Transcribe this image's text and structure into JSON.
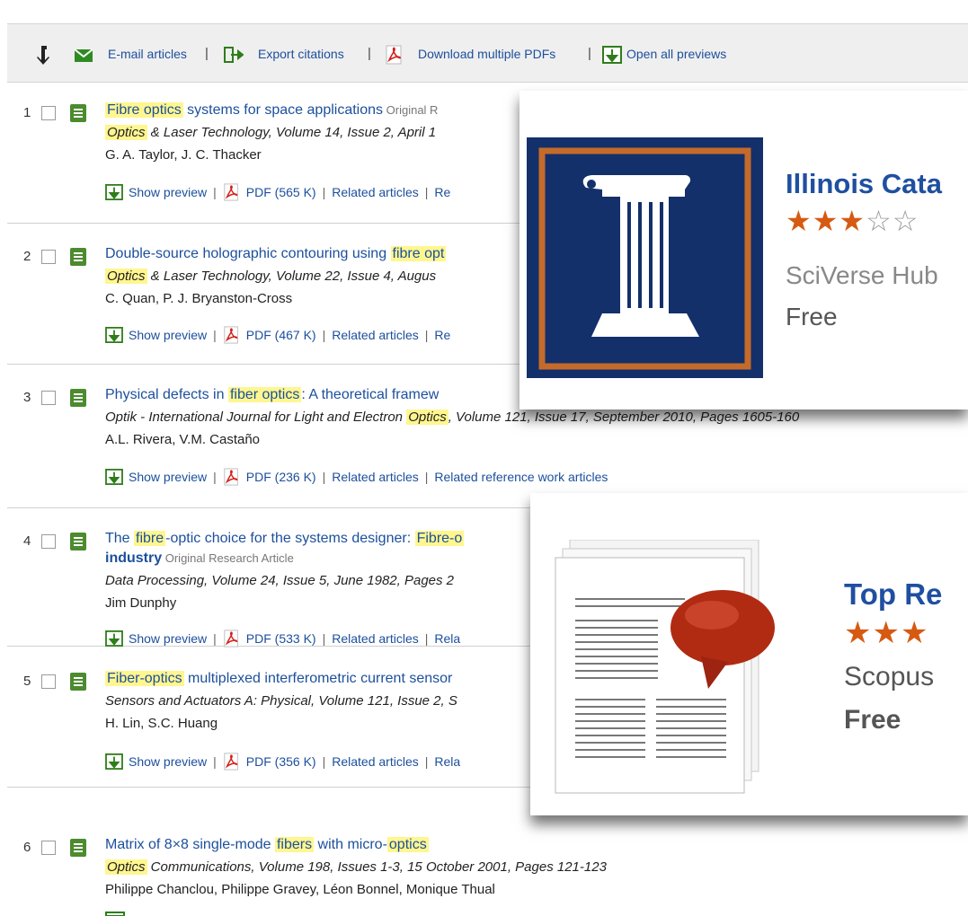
{
  "toolbar": {
    "email": "E-mail articles",
    "export": "Export citations",
    "download": "Download multiple PDFs",
    "open_previews": "Open all previews",
    "sep": "|"
  },
  "results": [
    {
      "num": "1",
      "title_hl": "Fibre optics",
      "title_rest": " systems for space applications",
      "type": " Original R",
      "src_hl": "Optics",
      "src_rest": " & Laser Technology, Volume 14, Issue 2, April 1",
      "authors": "G. A. Taylor, J. C. Thacker",
      "preview": "Show preview",
      "pdf": "PDF (565 K)",
      "related": "Related articles",
      "related_tail": "Re"
    },
    {
      "num": "2",
      "title_pre": "Double-source holographic contouring using ",
      "title_hl": "fibre opt",
      "src_hl": "Optics",
      "src_rest": " & Laser Technology, Volume 22, Issue 4, Augus",
      "authors": "C. Quan, P. J. Bryanston-Cross",
      "preview": "Show preview",
      "pdf": "PDF (467 K)",
      "related": "Related articles",
      "related_tail": "Re"
    },
    {
      "num": "3",
      "title_pre": "Physical defects in ",
      "title_hl": "fiber optics",
      "title_rest": ": A theoretical framew",
      "src_pre": "Optik - International Journal for Light and Electron ",
      "src_hl": "Optics",
      "src_rest": ", Volume 121, Issue 17, September 2010, Pages 1605-160",
      "authors": "A.L. Rivera, V.M. Castaño",
      "preview": "Show preview",
      "pdf": "PDF (236 K)",
      "related": "Related articles",
      "related_ref": "Related reference work articles"
    },
    {
      "num": "4",
      "title_pre": "The ",
      "title_hl": "fibre",
      "title_mid": "-optic choice for the systems designer: ",
      "title_hl2": "Fibre-o",
      "title_line2": "industry",
      "type": " Original Research Article",
      "src_rest": "Data Processing, Volume 24, Issue 5, June 1982, Pages 2",
      "authors": "Jim Dunphy",
      "preview": "Show preview",
      "pdf": "PDF (533 K)",
      "related": "Related articles",
      "related_tail": "Rela"
    },
    {
      "num": "5",
      "title_hl": "Fiber-optics",
      "title_rest": " multiplexed interferometric current sensor",
      "src_rest": "Sensors and Actuators A: Physical, Volume 121, Issue 2, S",
      "authors": "H. Lin, S.C. Huang",
      "preview": "Show preview",
      "pdf": "PDF (356 K)",
      "related": "Related articles",
      "related_tail": "Rela"
    },
    {
      "num": "6",
      "title_pre": "Matrix of 8×8 single-mode ",
      "title_hl": "fibers",
      "title_mid": " with micro-",
      "title_hl2": "optics",
      "src_hl": "Optics",
      "src_rest": " Communications, Volume 198, Issues 1-3, 15 October 2001, Pages 121-123",
      "authors": "Philippe Chanclou, Philippe Gravey, Léon Bonnel, Monique Thual"
    }
  ],
  "popups": [
    {
      "title": "Illinois Cata",
      "stars_full": "★★★",
      "stars_empty": "☆☆",
      "source": "SciVerse Hub",
      "price": "Free",
      "icon": "illinois-logo-icon",
      "rating": 3
    },
    {
      "title": "Top Re",
      "stars_full": "★★★",
      "source": "Scopus",
      "price": "Free",
      "icon": "document-speech-bubble-icon",
      "rating": 3
    }
  ],
  "colors": {
    "link": "#1c4f9c",
    "highlight": "#fff68f",
    "star": "#d65a12",
    "illinois_blue": "#13306a",
    "illinois_orange": "#c46a2b"
  }
}
